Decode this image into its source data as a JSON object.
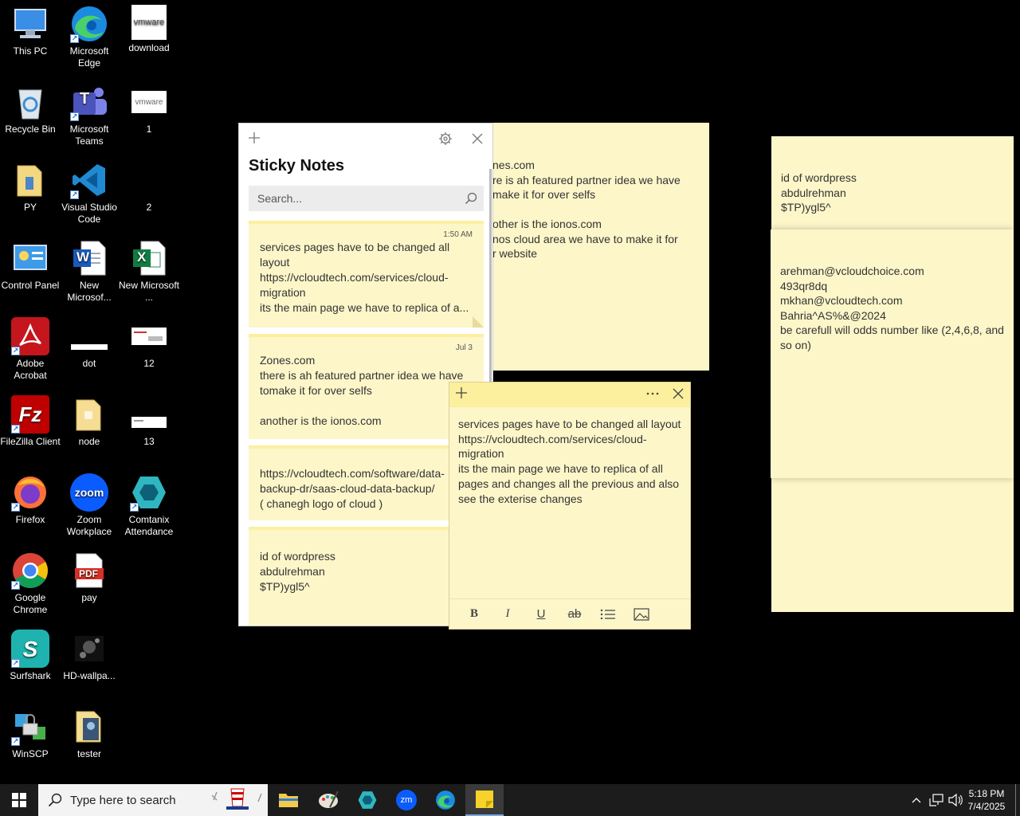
{
  "desktop_icons": [
    {
      "label": "This PC",
      "icon": "this-pc-icon"
    },
    {
      "label": "Microsoft Edge",
      "icon": "edge-icon"
    },
    {
      "label": "download",
      "icon": "vmware-icon",
      "logo_text": "vmware"
    },
    {
      "label": "Recycle Bin",
      "icon": "recycle-bin-icon"
    },
    {
      "label": "Microsoft Teams",
      "icon": "teams-icon",
      "logo_text": "T"
    },
    {
      "label": "1",
      "icon": "vmware-icon",
      "logo_text": "vmware"
    },
    {
      "label": "PY",
      "icon": "folder-icon"
    },
    {
      "label": "Visual Studio Code",
      "icon": "vscode-icon"
    },
    {
      "label": "2",
      "icon": "blank-file-icon"
    },
    {
      "label": "Control Panel",
      "icon": "control-panel-icon"
    },
    {
      "label": "New Microsof...",
      "icon": "word-icon",
      "logo_text": "W"
    },
    {
      "label": "New Microsoft ...",
      "icon": "excel-icon",
      "logo_text": "X"
    },
    {
      "label": "Adobe Acrobat",
      "icon": "acrobat-icon"
    },
    {
      "label": "dot",
      "icon": "image-file-icon"
    },
    {
      "label": "12",
      "icon": "image-file-icon"
    },
    {
      "label": "FileZilla Client",
      "icon": "filezilla-icon",
      "logo_text": "Fz"
    },
    {
      "label": "node",
      "icon": "folder-icon"
    },
    {
      "label": "13",
      "icon": "image-file-icon"
    },
    {
      "label": "Firefox",
      "icon": "firefox-icon"
    },
    {
      "label": "Zoom Workplace",
      "icon": "zoom-icon",
      "logo_text": "zoom"
    },
    {
      "label": "Comtanix Attendance",
      "icon": "comtanix-icon"
    },
    {
      "label": "Google Chrome",
      "icon": "chrome-icon"
    },
    {
      "label": "pay",
      "icon": "pdf-icon",
      "logo_text": "PDF"
    },
    {
      "label": "Surfshark",
      "icon": "surfshark-icon",
      "logo_text": "S"
    },
    {
      "label": "HD-wallpa...",
      "icon": "wallpaper-icon"
    },
    {
      "label": "WinSCP",
      "icon": "winscp-icon"
    },
    {
      "label": "tester",
      "icon": "folder-icon"
    }
  ],
  "sticky_window": {
    "title": "Sticky Notes",
    "search_placeholder": "Search...",
    "notes": [
      {
        "date": "1:50 AM",
        "text": "services pages have to be changed all layout\nhttps://vcloudtech.com/services/cloud-migration\nits the main page  we have to replica of a..."
      },
      {
        "date": "Jul 3",
        "text": "Zones.com\nthere is ah featured partner idea we have tomake it for over selfs\n\nanother is the ionos.com"
      },
      {
        "date": "",
        "text": "https://vcloudtech.com/software/data-backup-dr/saas-cloud-data-backup/\n( chanegh logo of cloud )"
      },
      {
        "date": "",
        "text": "id of wordpress\nabdulrehman\n$TP)ygl5^"
      }
    ]
  },
  "desktop_notes": {
    "zones_note": "nes.com\nre is ah featured partner idea we have\nmake it for over selfs\n\nother is the ionos.com\nnos cloud  area we have to make it for\nr  website",
    "right_top": "id of wordpress\nabdulrehman\n$TP)ygl5^",
    "right_bottom": "arehman@vcloudchoice.com\n493qr8dq\nmkhan@vcloudtech.com\nBahria^AS%&@2024\nbe carefull will odds number like (2,4,6,8, and so on)"
  },
  "active_note": {
    "text": "services pages have to be changed all layout\nhttps://vcloudtech.com/services/cloud-migration\nits the main page  we have to replica of all pages and changes all the previous and also see the  exterise changes",
    "toolbar": [
      "bold",
      "italic",
      "underline",
      "strikethrough",
      "bullets",
      "image"
    ],
    "bold_label": "B",
    "italic_label": "I",
    "underline_label": "U",
    "strike_label": "ab"
  },
  "taskbar": {
    "search_placeholder": "Type here to search",
    "time": "5:18 PM",
    "date": "7/4/2025",
    "apps": [
      "file-explorer-icon",
      "paint-icon",
      "comtanix-icon",
      "zoom-icon",
      "edge-icon",
      "sticky-notes-icon"
    ]
  },
  "colors": {
    "note_bg": "#fdf6c9",
    "note_header": "#fcef9e",
    "taskbar": "#1c1c1c"
  }
}
